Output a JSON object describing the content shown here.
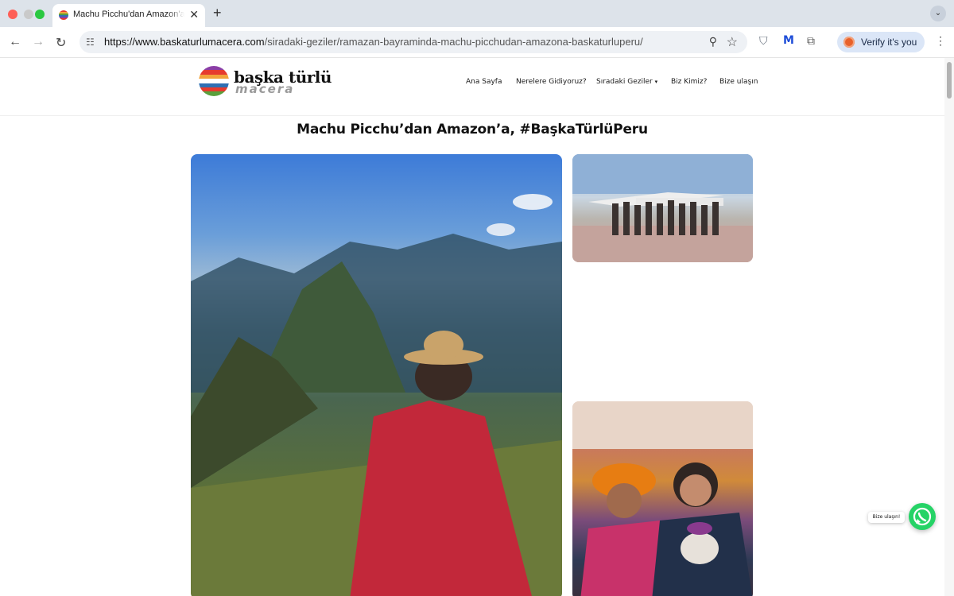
{
  "browser": {
    "tab_title": "Machu Picchu'dan Amazon'a, #BaşkaTürlüPeru | Başka Türlü Macera",
    "url_host": "https://www.baskaturlumacera.com",
    "url_path": "/siradaki-geziler/ramazan-bayraminda-machu-picchudan-amazona-baskaturluperu/",
    "verify_label": "Verify it's you"
  },
  "header": {
    "logo_line1": "başka türlü",
    "logo_line2": "macera",
    "nav": [
      {
        "label": "Ana Sayfa"
      },
      {
        "label": "Nerelere Gidiyoruz?"
      },
      {
        "label": "Sıradaki Geziler"
      },
      {
        "label": "Biz Kimiz?"
      },
      {
        "label": "Bize ulaşın"
      }
    ]
  },
  "main": {
    "title": "Machu Picchu’dan Amazon’a, #BaşkaTürlüPeru"
  },
  "whatsapp": {
    "label": "Bize ulaşın!"
  },
  "colors": {
    "whatsapp_green": "#25d366",
    "verify_chip": "#dbe6f7"
  }
}
